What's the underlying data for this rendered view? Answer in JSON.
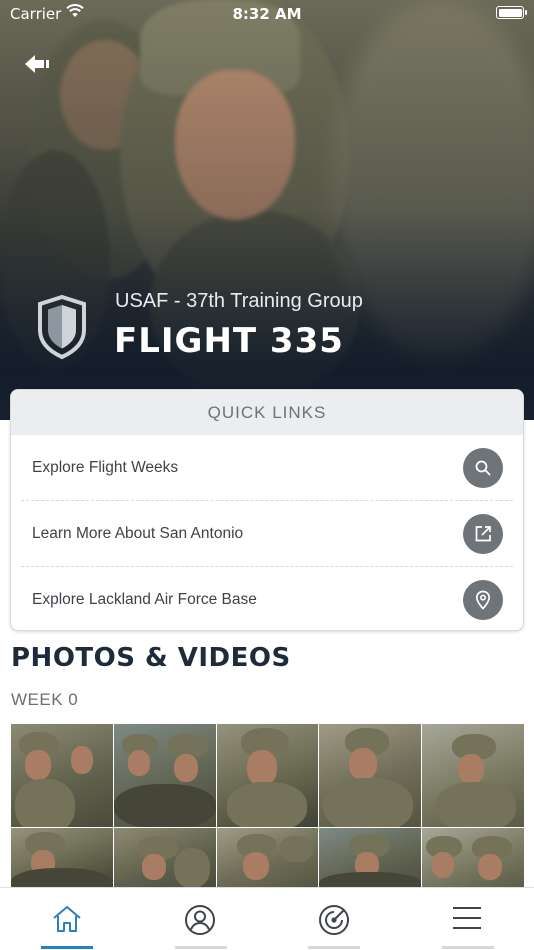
{
  "status_bar": {
    "carrier": "Carrier",
    "time": "8:32 AM"
  },
  "hero": {
    "subtitle": "USAF - 37th Training Group",
    "title": "FLIGHT 335"
  },
  "quick_links": {
    "header": "QUICK LINKS",
    "items": [
      {
        "label": "Explore Flight Weeks",
        "icon": "search-icon"
      },
      {
        "label": "Learn More About San Antonio",
        "icon": "external-link-icon"
      },
      {
        "label": "Explore Lackland Air Force Base",
        "icon": "map-pin-icon"
      }
    ]
  },
  "photos": {
    "title": "PHOTOS & VIDEOS",
    "week_label": "WEEK 0"
  },
  "tab_bar": {
    "tabs": [
      {
        "name": "home",
        "icon": "home-icon",
        "active": true
      },
      {
        "name": "profile",
        "icon": "user-icon",
        "active": false
      },
      {
        "name": "radar",
        "icon": "radar-icon",
        "active": false
      },
      {
        "name": "menu",
        "icon": "menu-icon",
        "active": false
      }
    ]
  },
  "colors": {
    "accent": "#2a7fbf",
    "heading_navy": "#1d2b3a",
    "icon_circle": "#6f7479",
    "quick_header_bg": "#ecedee"
  }
}
